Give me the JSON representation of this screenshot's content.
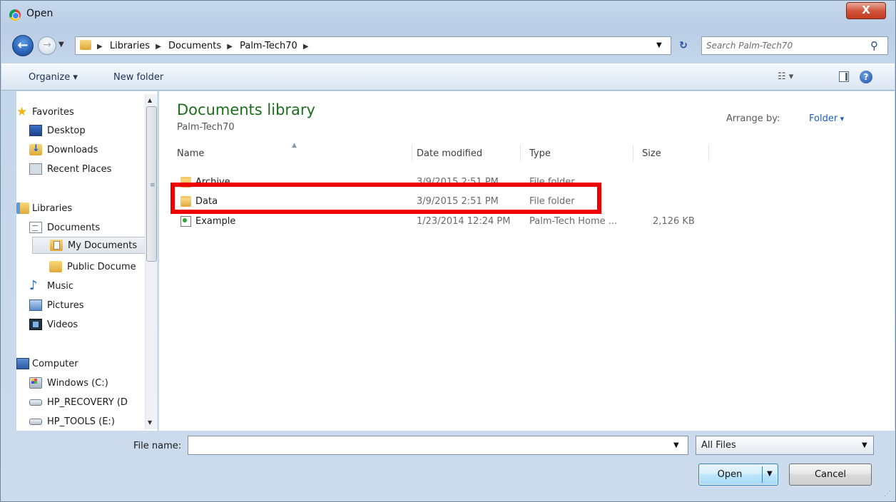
{
  "window": {
    "title": "Open",
    "close_label": "X"
  },
  "nav": {
    "breadcrumbs": [
      "Libraries",
      "Documents",
      "Palm-Tech70"
    ],
    "search_placeholder": "Search Palm-Tech70"
  },
  "toolbar": {
    "organize_label": "Organize ▾",
    "new_folder_label": "New folder"
  },
  "sidebar": {
    "items": [
      {
        "label": "Favorites",
        "icon": "star-icon"
      },
      {
        "label": "Desktop",
        "icon": "desktop-icon"
      },
      {
        "label": "Downloads",
        "icon": "downloads-folder-icon"
      },
      {
        "label": "Recent Places",
        "icon": "recent-places-icon"
      },
      {
        "label": "Libraries",
        "icon": "libraries-icon"
      },
      {
        "label": "Documents",
        "icon": "document-library-icon"
      },
      {
        "label": "My Documents",
        "icon": "my-documents-folder-icon"
      },
      {
        "label": "Public Docume",
        "icon": "folder-icon"
      },
      {
        "label": "Music",
        "icon": "music-icon"
      },
      {
        "label": "Pictures",
        "icon": "pictures-icon"
      },
      {
        "label": "Videos",
        "icon": "videos-icon"
      },
      {
        "label": "Computer",
        "icon": "computer-icon"
      },
      {
        "label": "Windows  (C:)",
        "icon": "windows-drive-icon"
      },
      {
        "label": "HP_RECOVERY (D",
        "icon": "drive-icon"
      },
      {
        "label": "HP_TOOLS (E:)",
        "icon": "drive-icon"
      }
    ]
  },
  "library": {
    "title": "Documents library",
    "subtitle": "Palm-Tech70",
    "arrange_label": "Arrange by:",
    "arrange_value": "Folder"
  },
  "columns": {
    "name": "Name",
    "date": "Date modified",
    "type": "Type",
    "size": "Size"
  },
  "files": [
    {
      "name": "Archive",
      "date": "3/9/2015 2:51 PM",
      "type": "File folder",
      "size": ""
    },
    {
      "name": "Data",
      "date": "3/9/2015 2:51 PM",
      "type": "File folder",
      "size": ""
    },
    {
      "name": "Example",
      "date": "1/23/2014 12:24 PM",
      "type": "Palm-Tech Home ...",
      "size": "2,126 KB"
    }
  ],
  "footer": {
    "file_name_label": "File name:",
    "file_name_value": "",
    "filter_value": "All Files",
    "open_label": "Open",
    "cancel_label": "Cancel"
  },
  "colors": {
    "highlight": "#ef0000",
    "library_title": "#1b6f1b",
    "link": "#1f5fb8"
  }
}
